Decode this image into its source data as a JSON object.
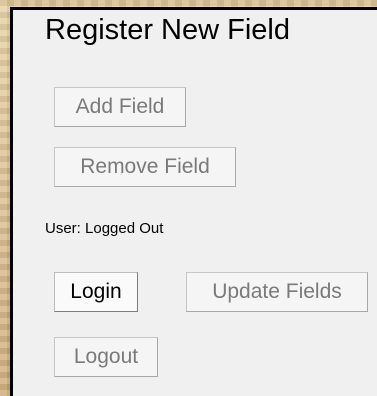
{
  "form": {
    "title": "Register New Field",
    "add_field_label": "Add Field",
    "remove_field_label": "Remove Field",
    "status_text": "User: Logged Out",
    "login_label": "Login",
    "update_fields_label": "Update Fields",
    "logout_label": "Logout"
  },
  "colors": {
    "panel_background": "#f0f0f0",
    "window_border": "#000000",
    "disabled_text": "#7a7a7a",
    "enabled_text": "#000000"
  }
}
